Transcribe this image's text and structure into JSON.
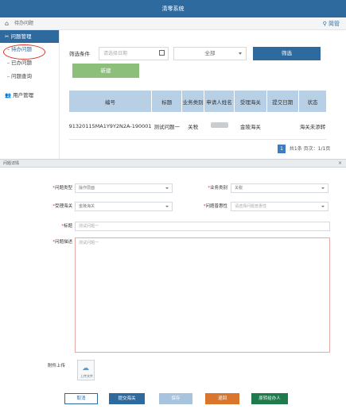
{
  "app": {
    "title": "清零系统"
  },
  "subbar": {
    "breadcrumb": "待办问题",
    "user": "简管"
  },
  "sidebar": {
    "group1": "问题管理",
    "items": [
      {
        "label": "待办问题",
        "active": true
      },
      {
        "label": "已办问题",
        "active": false
      },
      {
        "label": "问题查询",
        "active": false
      }
    ],
    "group2": "用户管理"
  },
  "filter": {
    "label": "筛选条件",
    "date_placeholder": "请选择日期",
    "select_value": "全部",
    "filter_button": "筛选",
    "new_button": "新建"
  },
  "table": {
    "headers": [
      "编号",
      "标题",
      "业务类别",
      "申请人姓名",
      "受理海关",
      "提交日期",
      "状态"
    ],
    "rows": [
      {
        "id": "91320115MA1Y9Y2N2A-190001",
        "title": "测试问题一",
        "category": "关税",
        "applicant": "",
        "customs": "金陵海关",
        "date": "",
        "status": "海关未添转"
      }
    ]
  },
  "pager": {
    "page": "1",
    "summary": "共1条 页次：1/1页"
  },
  "dialog": {
    "title": "问题详情",
    "fields": {
      "problem_type_label": "问题类型",
      "problem_type_value": "操作层面",
      "category_label": "业务类别",
      "category_value": "关税",
      "customs_label": "受理海关",
      "customs_value": "金陵海关",
      "general_label": "问题普惠性",
      "general_placeholder": "请选择问题普惠性",
      "title_label": "标题",
      "title_value": "测试问题一",
      "desc_label": "问题描述",
      "desc_value": "测试问题一"
    },
    "upload_label": "附件上传",
    "upload_caption": "上传文件",
    "buttons": {
      "back": "取消",
      "submit": "提交海关",
      "save": "保存",
      "return": "退回",
      "assign": "原转给办人"
    }
  },
  "colors": {
    "primary": "#2f6a9f",
    "success": "#8cc07a",
    "danger": "#d8352c",
    "warning": "#d9762b",
    "dark_green": "#1f7a4d"
  }
}
